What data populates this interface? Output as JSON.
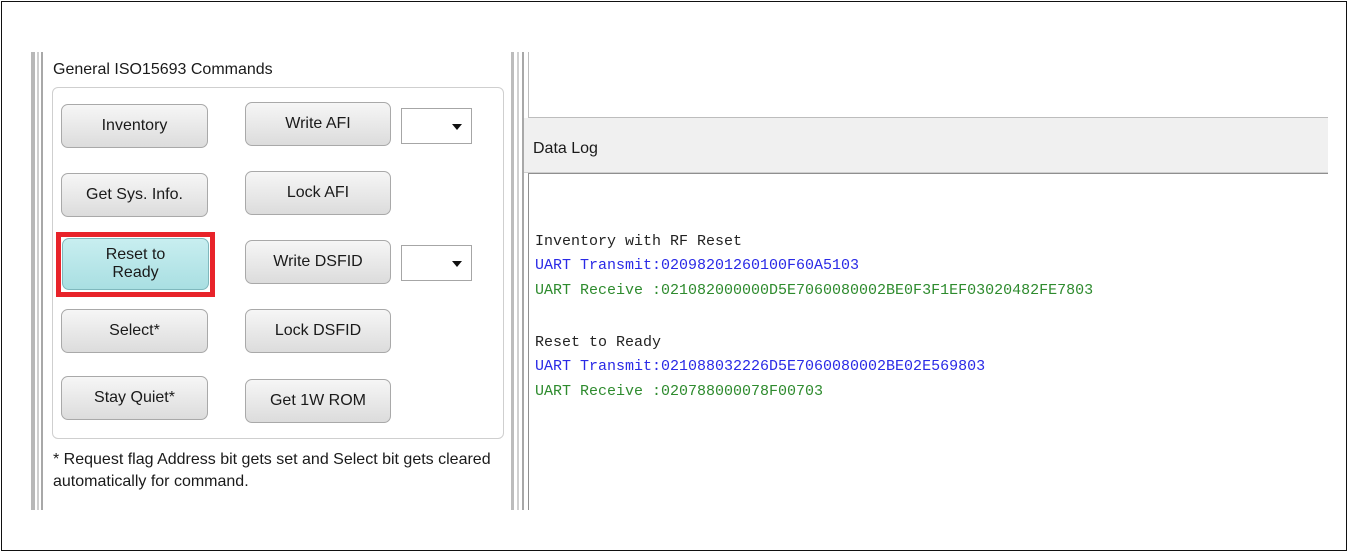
{
  "commands_group": {
    "title": "General ISO15693 Commands",
    "buttons": {
      "inventory": "Inventory",
      "write_afi": "Write AFI",
      "get_sys_info": "Get Sys. Info.",
      "lock_afi": "Lock AFI",
      "reset_to_ready": "Reset to Ready",
      "write_dsfid": "Write DSFID",
      "select": "Select*",
      "lock_dsfid": "Lock DSFID",
      "stay_quiet": "Stay Quiet*",
      "get_1w_rom": "Get 1W ROM"
    },
    "afi_combo_value": "",
    "dsfid_combo_value": "",
    "note": "* Request flag Address bit gets set and Select bit gets cleared automatically for command."
  },
  "data_log": {
    "title": "Data Log",
    "entries": [
      {
        "text": "Inventory with RF Reset",
        "color": "#222222"
      },
      {
        "text": "UART Transmit:02098201260100F60A5103",
        "color": "#2a2ae6"
      },
      {
        "text": "UART Receive :021082000000D5E7060080002BE0F3F1EF03020482FE7803",
        "color": "#2e8b2e"
      },
      {
        "text": "Reset to Ready",
        "color": "#222222"
      },
      {
        "text": "UART Transmit:021088032226D5E7060080002BE02E569803",
        "color": "#2a2ae6"
      },
      {
        "text": "UART Receive :020788000078F00703",
        "color": "#2e8b2e"
      }
    ]
  },
  "highlight_color": "#e8232a"
}
